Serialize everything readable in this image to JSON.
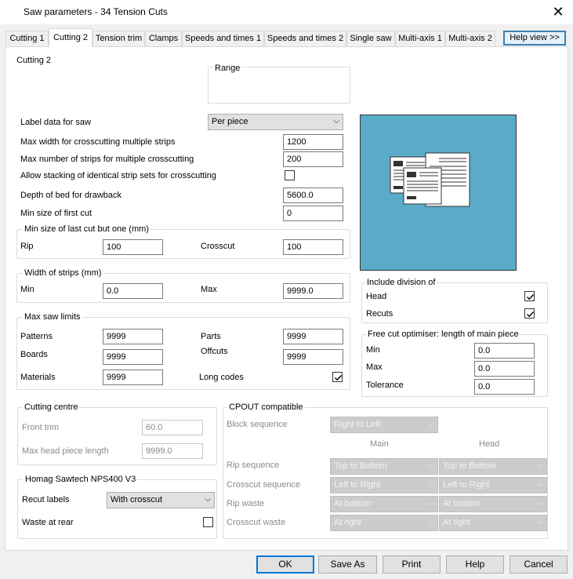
{
  "window": {
    "title": "Saw parameters - 34 Tension Cuts"
  },
  "tabs": [
    "Cutting 1",
    "Cutting 2",
    "Tension trim",
    "Clamps",
    "Speeds and times 1",
    "Speeds and times 2",
    "Single saw",
    "Multi-axis 1",
    "Multi-axis 2"
  ],
  "active_tab": "Cutting 2",
  "help_view": "Help view >>",
  "page": {
    "heading": "Cutting 2",
    "range_label": "Range",
    "label_data": {
      "label": "Label data for saw",
      "value": "Per piece"
    },
    "max_width": {
      "label": "Max width for crosscutting multiple strips",
      "value": "1200"
    },
    "max_strips": {
      "label": "Max number of strips for multiple crosscutting",
      "value": "200"
    },
    "allow_stacking": {
      "label": "Allow stacking of identical strip sets for crosscutting",
      "checked": false
    },
    "depth_bed": {
      "label": "Depth of bed for drawback",
      "value": "5600.0"
    },
    "min_first_cut": {
      "label": "Min size of first cut",
      "value": "0"
    },
    "last_cut_group": {
      "title": "Min size of last cut but one (mm)",
      "rip_label": "Rip",
      "rip_value": "100",
      "crosscut_label": "Crosscut",
      "crosscut_value": "100"
    },
    "width_strips_group": {
      "title": "Width of strips (mm)",
      "min_label": "Min",
      "min_value": "0.0",
      "max_label": "Max",
      "max_value": "9999.0"
    },
    "saw_limits_group": {
      "title": "Max saw limits",
      "patterns_label": "Patterns",
      "patterns_value": "9999",
      "parts_label": "Parts",
      "parts_value": "9999",
      "boards_label": "Boards",
      "boards_value": "9999",
      "offcuts_label": "Offcuts",
      "offcuts_value": "9999",
      "materials_label": "Materials",
      "materials_value": "9999",
      "long_codes_label": "Long codes",
      "long_codes_checked": true
    },
    "include_division": {
      "title": "Include division of",
      "head_label": "Head",
      "head_checked": true,
      "recuts_label": "Recuts",
      "recuts_checked": true
    },
    "free_cut": {
      "title": "Free cut optimiser: length of main piece",
      "min_label": "Min",
      "min_value": "0.0",
      "max_label": "Max",
      "max_value": "0.0",
      "tol_label": "Tolerance",
      "tol_value": "0.0"
    },
    "cutting_centre": {
      "title": "Cutting centre",
      "front_trim_label": "Front trim",
      "front_trim_value": "60.0",
      "max_head_label": "Max head piece length",
      "max_head_value": "9999.0"
    },
    "homag": {
      "title": "Homag Sawtech NPS400 V3",
      "recut_label": "Recut labels",
      "recut_value": "With crosscut",
      "waste_label": "Waste at rear",
      "waste_checked": false
    },
    "cpout": {
      "title": "CPOUT compatible",
      "block_seq_label": "Block sequence",
      "block_seq_value": "Right to Left",
      "main_header": "Main",
      "head_header": "Head",
      "rip_seq_label": "Rip sequence",
      "rip_seq_main": "Top to Bottom",
      "rip_seq_head": "Top to Bottom",
      "cross_seq_label": "Crosscut sequence",
      "cross_seq_main": "Left to Right",
      "cross_seq_head": "Left to Right",
      "rip_waste_label": "Rip waste",
      "rip_waste_main": "At bottom",
      "rip_waste_head": "At bottom",
      "cross_waste_label": "Crosscut waste",
      "cross_waste_main": "At right",
      "cross_waste_head": "At right"
    }
  },
  "buttons": {
    "ok": "OK",
    "save_as": "Save As",
    "print": "Print",
    "help": "Help",
    "cancel": "Cancel"
  },
  "colors": {
    "preview_bg": "#5aabc9",
    "accent": "#0078d7"
  }
}
